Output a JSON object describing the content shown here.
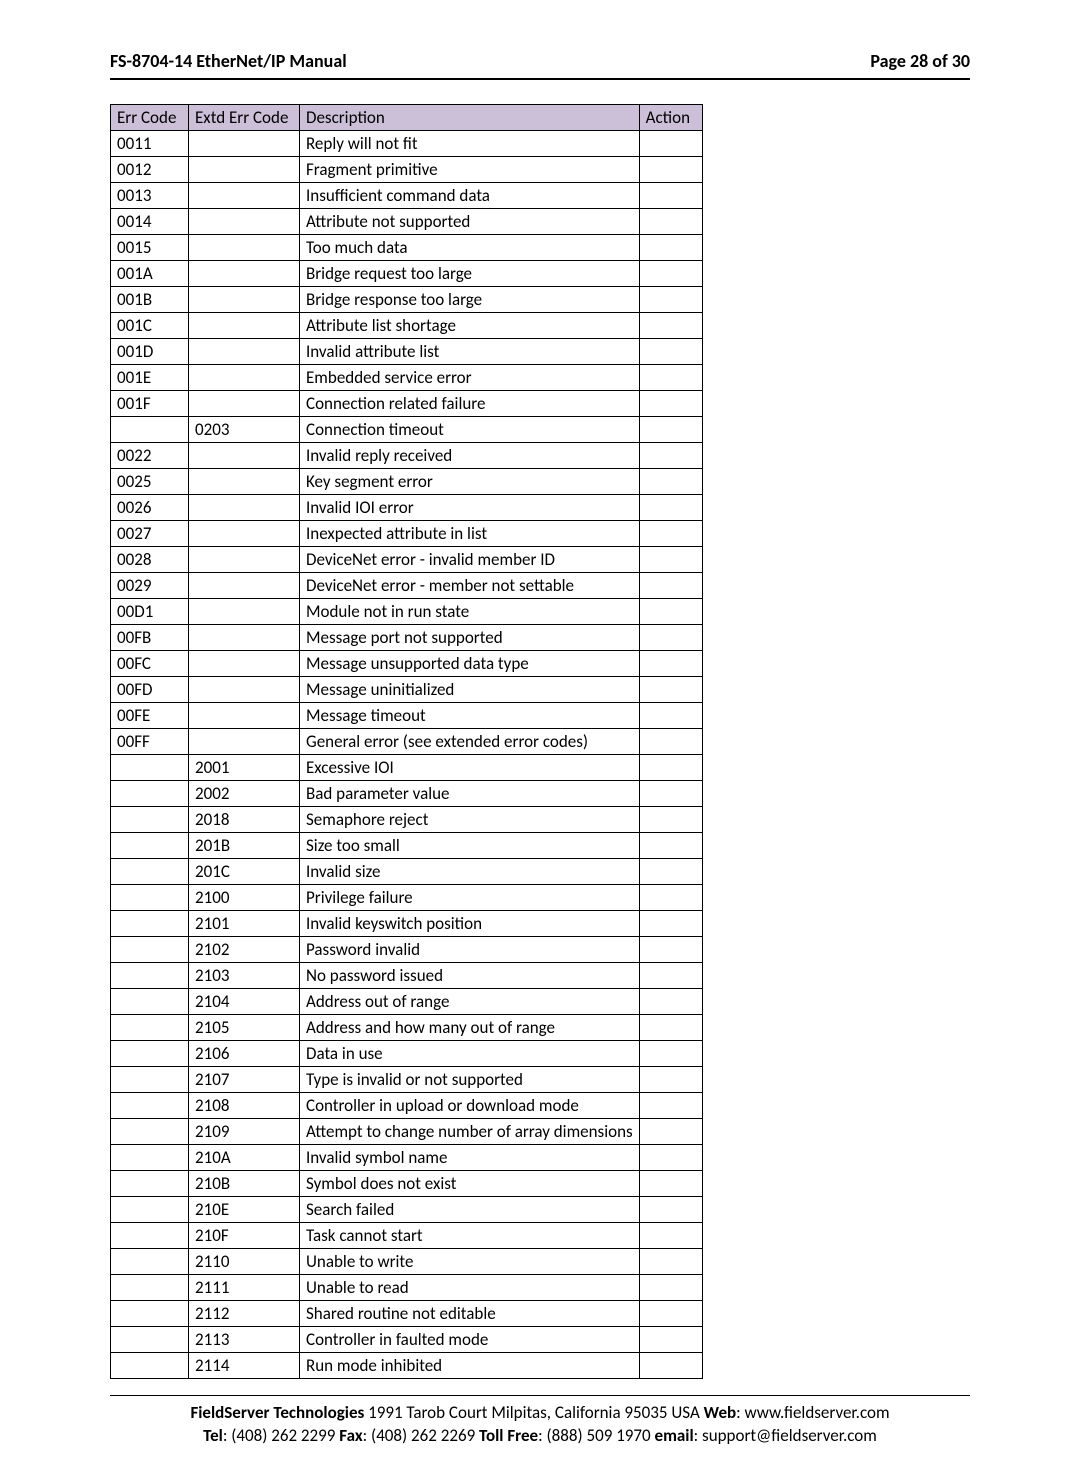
{
  "header": {
    "title": "FS-8704-14 EtherNet/IP Manual",
    "page_label": "Page 28 of 30"
  },
  "table": {
    "headers": {
      "err": "Err Code",
      "extd": "Extd Err Code",
      "desc": "Description",
      "act": "Action"
    },
    "rows": [
      {
        "err": "0011",
        "extd": "",
        "desc": "Reply will not fit",
        "act": ""
      },
      {
        "err": "0012",
        "extd": "",
        "desc": "Fragment primitive",
        "act": ""
      },
      {
        "err": "0013",
        "extd": "",
        "desc": "Insufficient command data",
        "act": ""
      },
      {
        "err": "0014",
        "extd": "",
        "desc": "Attribute not supported",
        "act": ""
      },
      {
        "err": "0015",
        "extd": "",
        "desc": "Too much data",
        "act": ""
      },
      {
        "err": "001A",
        "extd": "",
        "desc": "Bridge request too large",
        "act": ""
      },
      {
        "err": "001B",
        "extd": "",
        "desc": "Bridge response too large",
        "act": ""
      },
      {
        "err": "001C",
        "extd": "",
        "desc": "Attribute list shortage",
        "act": ""
      },
      {
        "err": "001D",
        "extd": "",
        "desc": "Invalid attribute list",
        "act": ""
      },
      {
        "err": "001E",
        "extd": "",
        "desc": "Embedded service error",
        "act": ""
      },
      {
        "err": "001F",
        "extd": "",
        "desc": "Connection related failure",
        "act": ""
      },
      {
        "err": "",
        "extd": "0203",
        "desc": "Connection timeout",
        "act": ""
      },
      {
        "err": "0022",
        "extd": "",
        "desc": "Invalid reply received",
        "act": ""
      },
      {
        "err": "0025",
        "extd": "",
        "desc": "Key segment error",
        "act": ""
      },
      {
        "err": "0026",
        "extd": "",
        "desc": "Invalid IOI error",
        "act": ""
      },
      {
        "err": "0027",
        "extd": "",
        "desc": "Inexpected attribute in list",
        "act": ""
      },
      {
        "err": "0028",
        "extd": "",
        "desc": "DeviceNet error - invalid member ID",
        "act": ""
      },
      {
        "err": "0029",
        "extd": "",
        "desc": "DeviceNet error - member not settable",
        "act": ""
      },
      {
        "err": "00D1",
        "extd": "",
        "desc": "Module not in run state",
        "act": ""
      },
      {
        "err": "00FB",
        "extd": "",
        "desc": "Message port not supported",
        "act": ""
      },
      {
        "err": "00FC",
        "extd": "",
        "desc": "Message unsupported data type",
        "act": ""
      },
      {
        "err": "00FD",
        "extd": "",
        "desc": "Message uninitialized",
        "act": ""
      },
      {
        "err": "00FE",
        "extd": "",
        "desc": "Message timeout",
        "act": ""
      },
      {
        "err": "00FF",
        "extd": "",
        "desc": "General error (see extended error codes)",
        "act": ""
      },
      {
        "err": "",
        "extd": "2001",
        "desc": "Excessive IOI",
        "act": ""
      },
      {
        "err": "",
        "extd": "2002",
        "desc": "Bad parameter value",
        "act": ""
      },
      {
        "err": "",
        "extd": "2018",
        "desc": "Semaphore reject",
        "act": ""
      },
      {
        "err": "",
        "extd": "201B",
        "desc": "Size too small",
        "act": ""
      },
      {
        "err": "",
        "extd": "201C",
        "desc": "Invalid size",
        "act": ""
      },
      {
        "err": "",
        "extd": "2100",
        "desc": "Privilege failure",
        "act": ""
      },
      {
        "err": "",
        "extd": "2101",
        "desc": "Invalid keyswitch position",
        "act": ""
      },
      {
        "err": "",
        "extd": "2102",
        "desc": "Password invalid",
        "act": ""
      },
      {
        "err": "",
        "extd": "2103",
        "desc": "No password issued",
        "act": ""
      },
      {
        "err": "",
        "extd": "2104",
        "desc": "Address out of range",
        "act": ""
      },
      {
        "err": "",
        "extd": "2105",
        "desc": "Address and how many out of range",
        "act": ""
      },
      {
        "err": "",
        "extd": "2106",
        "desc": "Data in use",
        "act": ""
      },
      {
        "err": "",
        "extd": "2107",
        "desc": "Type is invalid or not supported",
        "act": ""
      },
      {
        "err": "",
        "extd": "2108",
        "desc": "Controller in upload or download mode",
        "act": ""
      },
      {
        "err": "",
        "extd": "2109",
        "desc": "Attempt to change number of array dimensions",
        "act": ""
      },
      {
        "err": "",
        "extd": "210A",
        "desc": "Invalid symbol name",
        "act": ""
      },
      {
        "err": "",
        "extd": "210B",
        "desc": "Symbol does not exist",
        "act": ""
      },
      {
        "err": "",
        "extd": "210E",
        "desc": "Search failed",
        "act": ""
      },
      {
        "err": "",
        "extd": "210F",
        "desc": "Task cannot start",
        "act": ""
      },
      {
        "err": "",
        "extd": "2110",
        "desc": "Unable to write",
        "act": ""
      },
      {
        "err": "",
        "extd": "2111",
        "desc": "Unable to read",
        "act": ""
      },
      {
        "err": "",
        "extd": "2112",
        "desc": "Shared routine not editable",
        "act": ""
      },
      {
        "err": "",
        "extd": "2113",
        "desc": "Controller in faulted mode",
        "act": ""
      },
      {
        "err": "",
        "extd": "2114",
        "desc": "Run mode inhibited",
        "act": ""
      }
    ]
  },
  "footer": {
    "company": "FieldServer Technologies",
    "address": " 1991 Tarob Court Milpitas, California 95035 USA   ",
    "web_label": "Web",
    "web_value": ": www.fieldserver.com",
    "tel_label": "Tel",
    "tel_value": ": (408) 262 2299   ",
    "fax_label": "Fax",
    "fax_value": ": (408) 262 2269   ",
    "tollfree_label": "Toll Free",
    "tollfree_value": ": (888) 509 1970   ",
    "email_label": "email",
    "email_value": ": support@fieldserver.com"
  }
}
